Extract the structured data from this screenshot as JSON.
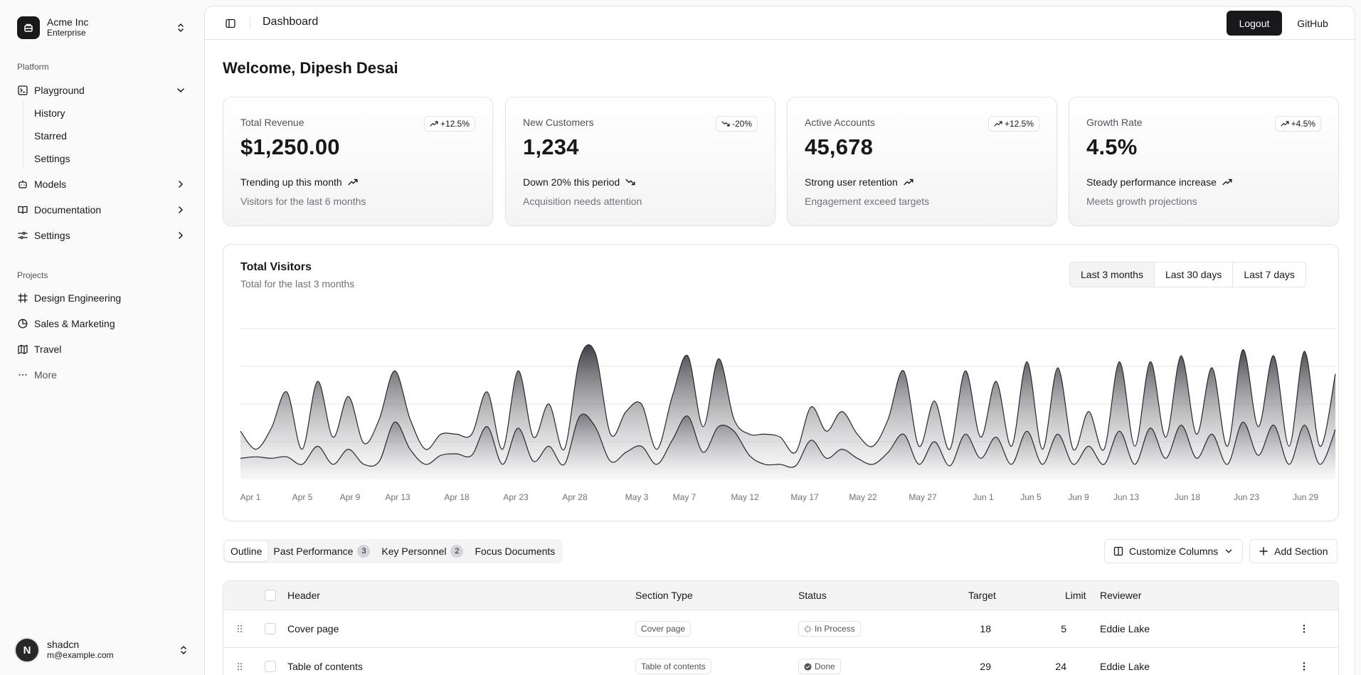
{
  "sidebar": {
    "team": {
      "name": "Acme Inc",
      "plan": "Enterprise"
    },
    "platform_label": "Platform",
    "nav": [
      {
        "label": "Playground"
      },
      {
        "label": "Models"
      },
      {
        "label": "Documentation"
      },
      {
        "label": "Settings"
      }
    ],
    "playground_sub": [
      {
        "label": "History"
      },
      {
        "label": "Starred"
      },
      {
        "label": "Settings"
      }
    ],
    "projects_label": "Projects",
    "projects": [
      {
        "label": "Design Engineering"
      },
      {
        "label": "Sales & Marketing"
      },
      {
        "label": "Travel"
      }
    ],
    "more_label": "More",
    "user": {
      "initial": "N",
      "name": "shadcn",
      "email": "m@example.com"
    }
  },
  "header": {
    "title": "Dashboard",
    "logout_label": "Logout",
    "github_label": "GitHub"
  },
  "welcome": "Welcome, Dipesh Desai",
  "cards": [
    {
      "label": "Total Revenue",
      "value": "$1,250.00",
      "badge": "+12.5%",
      "trend": "up",
      "footer": "Trending up this month",
      "sub": "Visitors for the last 6 months"
    },
    {
      "label": "New Customers",
      "value": "1,234",
      "badge": "-20%",
      "trend": "down",
      "footer": "Down 20% this period",
      "sub": "Acquisition needs attention"
    },
    {
      "label": "Active Accounts",
      "value": "45,678",
      "badge": "+12.5%",
      "trend": "up",
      "footer": "Strong user retention",
      "sub": "Engagement exceed targets"
    },
    {
      "label": "Growth Rate",
      "value": "4.5%",
      "badge": "+4.5%",
      "trend": "up",
      "footer": "Steady performance increase",
      "sub": "Meets growth projections"
    }
  ],
  "visitors": {
    "title": "Total Visitors",
    "description": "Total for the last 3 months",
    "ranges": [
      "Last 3 months",
      "Last 30 days",
      "Last 7 days"
    ],
    "selected_range": "Last 3 months"
  },
  "chart_data": {
    "type": "area",
    "x_tick_labels": [
      "Apr 1",
      "Apr 5",
      "Apr 9",
      "Apr 13",
      "Apr 18",
      "Apr 23",
      "Apr 28",
      "May 3",
      "May 7",
      "May 12",
      "May 17",
      "May 22",
      "May 27",
      "Jun 1",
      "Jun 5",
      "Jun 9",
      "Jun 13",
      "Jun 18",
      "Jun 23",
      "Jun 29"
    ],
    "grid": true,
    "ylim": [
      0,
      100
    ],
    "series": [
      {
        "values": [
          32,
          20,
          34,
          58,
          20,
          65,
          28,
          55,
          24,
          40,
          72,
          40,
          20,
          30,
          30,
          30,
          58,
          20,
          72,
          28,
          50,
          20,
          80,
          84,
          30,
          45,
          50,
          20,
          55,
          82,
          35,
          80,
          40,
          30,
          30,
          28,
          18,
          48,
          32,
          45,
          30,
          22,
          40,
          72,
          22,
          52,
          20,
          72,
          28,
          65,
          22,
          78,
          20,
          74,
          20,
          45,
          20,
          78,
          22,
          78,
          28,
          82,
          30,
          74,
          22,
          86,
          35,
          82,
          22,
          85,
          22,
          70
        ]
      },
      {
        "values": [
          14,
          15,
          14,
          15,
          10,
          22,
          10,
          20,
          10,
          12,
          38,
          20,
          10,
          16,
          17,
          16,
          35,
          10,
          34,
          12,
          22,
          10,
          42,
          35,
          12,
          18,
          22,
          10,
          26,
          42,
          18,
          35,
          32,
          16,
          10,
          10,
          9,
          26,
          14,
          20,
          14,
          10,
          18,
          30,
          10,
          25,
          9,
          30,
          14,
          28,
          10,
          32,
          10,
          30,
          10,
          22,
          10,
          32,
          10,
          34,
          14,
          36,
          14,
          30,
          10,
          38,
          16,
          36,
          10,
          36,
          10,
          33
        ]
      }
    ]
  },
  "tabs": [
    {
      "label": "Outline",
      "count": ""
    },
    {
      "label": "Past Performance",
      "count": "3"
    },
    {
      "label": "Key Personnel",
      "count": "2"
    },
    {
      "label": "Focus Documents",
      "count": ""
    }
  ],
  "actions": {
    "customize_label": "Customize Columns",
    "add_section_label": "Add Section"
  },
  "table": {
    "columns": [
      "Header",
      "Section Type",
      "Status",
      "Target",
      "Limit",
      "Reviewer"
    ],
    "rows": [
      {
        "header": "Cover page",
        "section_type": "Cover page",
        "status": "In Process",
        "target": "18",
        "limit": "5",
        "reviewer": "Eddie Lake"
      },
      {
        "header": "Table of contents",
        "section_type": "Table of contents",
        "status": "Done",
        "target": "29",
        "limit": "24",
        "reviewer": "Eddie Lake"
      }
    ]
  }
}
